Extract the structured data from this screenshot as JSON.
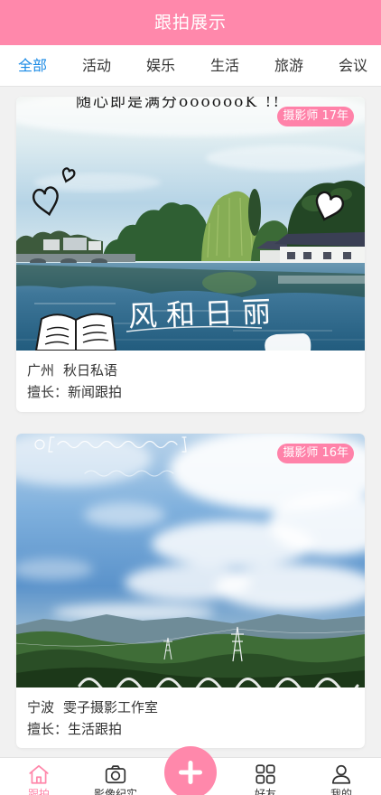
{
  "colors": {
    "primary": "#ff88ab",
    "badge": "#ff82a9",
    "tab_active": "#1a8ae5",
    "text": "#333333",
    "background": "#f1f1f1"
  },
  "header": {
    "title": "跟拍展示"
  },
  "tabs": [
    {
      "label": "全部",
      "active": true
    },
    {
      "label": "活动",
      "active": false
    },
    {
      "label": "娱乐",
      "active": false
    },
    {
      "label": "生活",
      "active": false
    },
    {
      "label": "旅游",
      "active": false
    },
    {
      "label": "会议",
      "active": false
    }
  ],
  "cards": [
    {
      "city": "广州",
      "name": "秋日私语",
      "specialty_label": "擅长：",
      "specialty": "新闻跟拍",
      "badge": "摄影师 17年",
      "photo_lettering": {
        "top": "随心即是满分ooooooK !!",
        "main": "风和日丽"
      }
    },
    {
      "city": "宁波",
      "name": "雯子摄影工作室",
      "specialty_label": "擅长：",
      "specialty": "生活跟拍",
      "badge": "摄影师 16年"
    }
  ],
  "bottom_nav": {
    "items": [
      {
        "label": "跟拍",
        "icon": "home-icon",
        "active": true
      },
      {
        "label": "影像纪实",
        "icon": "camera-icon",
        "active": false
      },
      {
        "label": "好友",
        "icon": "grid-icon",
        "active": false
      },
      {
        "label": "我的",
        "icon": "user-icon",
        "active": false
      }
    ],
    "add_button_icon": "plus-icon"
  }
}
